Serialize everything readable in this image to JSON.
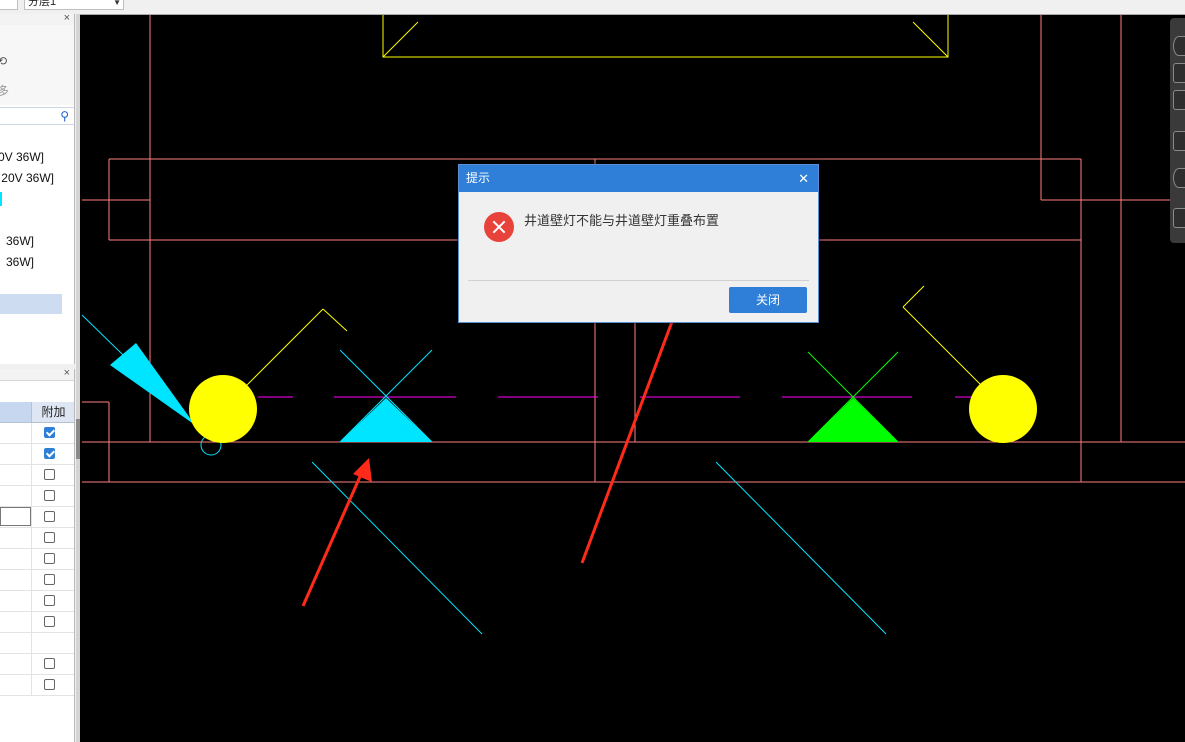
{
  "topbar": {
    "combo_left": "",
    "combo_floor": "分层1"
  },
  "left_top_panel": {
    "prop_lines": [
      "⟲",
      "多"
    ],
    "tree_items": [
      "0V 36W]",
      "20V 36W]",
      "36W]",
      "36W]"
    ]
  },
  "left_table_panel": {
    "column_header": "附加",
    "rows": [
      {
        "checked": true
      },
      {
        "checked": true
      },
      {
        "checked": false
      },
      {
        "checked": false
      },
      {
        "checked": false
      },
      {
        "checked": false
      },
      {
        "checked": false
      },
      {
        "checked": false
      },
      {
        "checked": false
      },
      {
        "checked": false
      },
      {
        "checked": null
      },
      {
        "checked": false
      },
      {
        "checked": false
      }
    ]
  },
  "dialog": {
    "title": "提示",
    "message": "井道壁灯不能与井道壁灯重叠布置",
    "close_button": "关闭",
    "close_icon": "close-icon",
    "status_icon": "error-icon"
  },
  "colors": {
    "accent": "#2f7fd9",
    "wall_lines": "#ff7f7f",
    "yellow_symbol": "#ffff00",
    "cyan_symbol": "#00e5ff",
    "green_symbol": "#00ff00",
    "magenta_line": "#ff00ff",
    "arrow": "#ff2a1a",
    "error": "#e8433a"
  }
}
